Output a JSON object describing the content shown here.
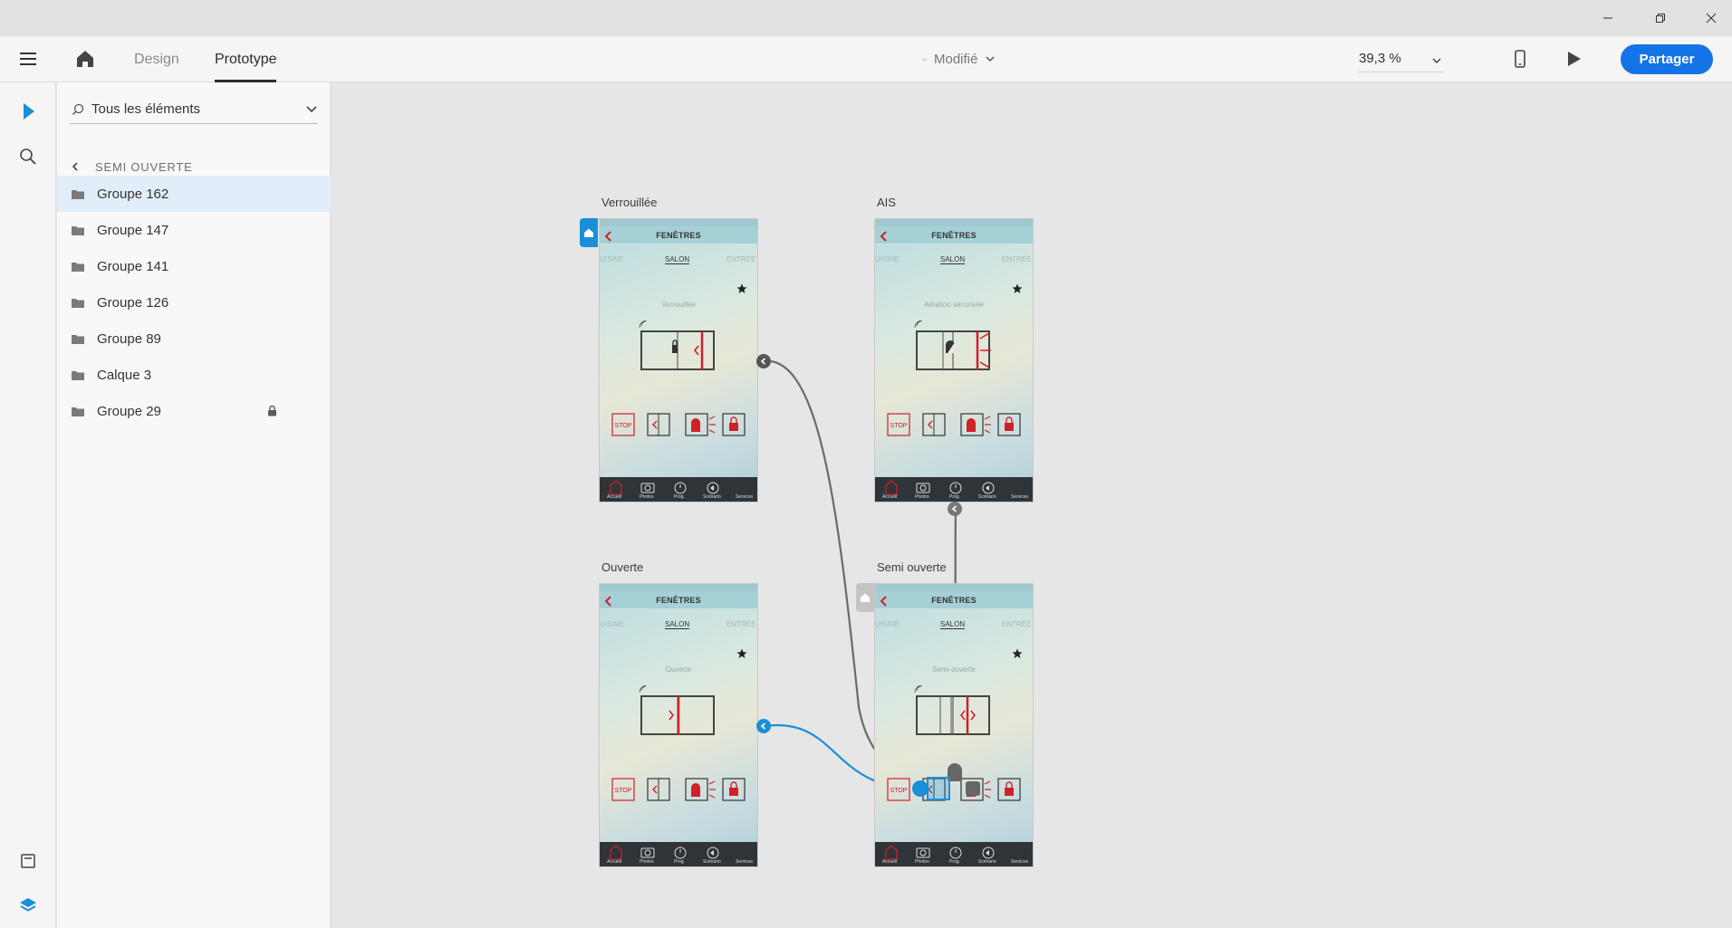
{
  "window": {
    "minimize_icon": "minimize-icon",
    "restore_icon": "restore-icon",
    "close_icon": "close-icon"
  },
  "header": {
    "tabs": [
      {
        "label": "Design",
        "active": false
      },
      {
        "label": "Prototype",
        "active": true
      }
    ],
    "status": "Modifié",
    "zoom": "39,3 %",
    "share_label": "Partager",
    "accent": "#1473e6"
  },
  "layers_panel": {
    "filter": "Tous les éléments",
    "breadcrumb": "SEMI OUVERTE",
    "items": [
      {
        "label": "Groupe 162",
        "selected": true,
        "locked": false
      },
      {
        "label": "Groupe 147",
        "selected": false,
        "locked": false
      },
      {
        "label": "Groupe 141",
        "selected": false,
        "locked": false
      },
      {
        "label": "Groupe 126",
        "selected": false,
        "locked": false
      },
      {
        "label": "Groupe 89",
        "selected": false,
        "locked": false
      },
      {
        "label": "Calque 3",
        "selected": false,
        "locked": false
      },
      {
        "label": "Groupe 29",
        "selected": false,
        "locked": true
      }
    ]
  },
  "artboards": [
    {
      "title": "Verrouillée",
      "screen_title": "FENÊTRES",
      "rooms": [
        "UISINE",
        "SALON",
        "ENTRÉE"
      ],
      "state": "Verrouillée"
    },
    {
      "title": "AIS",
      "screen_title": "FENÊTRES",
      "rooms": [
        "UISINE",
        "SALON",
        "ENTRÉE"
      ],
      "state": "Aération sécurisée"
    },
    {
      "title": "Ouverte",
      "screen_title": "FENÊTRES",
      "rooms": [
        "UISINE",
        "SALON",
        "ENTRÉE"
      ],
      "state": "Ouverte"
    },
    {
      "title": "Semi ouverte",
      "screen_title": "FENÊTRES",
      "rooms": [
        "UISINE",
        "SALON",
        "ENTRÉE"
      ],
      "state": "Semi-ouverte"
    }
  ],
  "screen": {
    "stop_label": "STOP",
    "tabbar": [
      "Accueil",
      "Photos",
      "Prog.",
      "Scénario",
      "Services"
    ]
  },
  "colors": {
    "link_selected": "#1a8fd8",
    "link_default": "#6b6b6b",
    "control_red": "#d0202a"
  }
}
